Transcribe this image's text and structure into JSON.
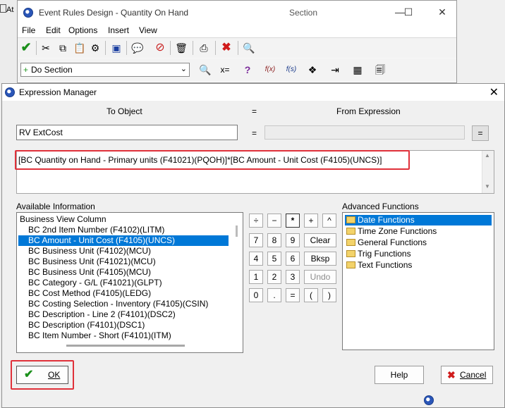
{
  "background_window": {
    "partial_label": "At"
  },
  "event_rules_window": {
    "title": "Event Rules Design - Quantity On Hand",
    "section_label": "Section",
    "menu": [
      "File",
      "Edit",
      "Options",
      "Insert",
      "View"
    ],
    "combo_value": "Do Section",
    "formula_icons": [
      "f(x)",
      "f(s)"
    ],
    "tb2_equals": "x=",
    "tb2_question": "?"
  },
  "dialog": {
    "title": "Expression Manager",
    "to_object_header": "To Object",
    "equals_header": "=",
    "from_expression_header": "From Expression",
    "to_object_value": "RV ExtCost",
    "equals_sign": "=",
    "equals_button": "=",
    "expression": "[BC Quantity on Hand - Primary units (F41021)(PQOH)]*[BC Amount - Unit Cost (F4105)(UNCS)]",
    "available_info_label": "Available Information",
    "list_header": "Business View Column",
    "list_items": [
      "BC 2nd Item Number (F4102)(LITM)",
      "BC Amount - Unit Cost (F4105)(UNCS)",
      "BC Business Unit (F4102)(MCU)",
      "BC Business Unit (F41021)(MCU)",
      "BC Business Unit (F4105)(MCU)",
      "BC Category - G/L (F41021)(GLPT)",
      "BC Cost Method (F4105)(LEDG)",
      "BC Costing Selection - Inventory (F4105)(CSIN)",
      "BC Description - Line 2 (F4101)(DSC2)",
      "BC Description (F4101)(DSC1)",
      "BC Item Number - Short (F4101)(ITM)"
    ],
    "selected_list_item_index": 1,
    "keypad": {
      "operators": [
        "÷",
        "−",
        "*",
        "+",
        "^"
      ],
      "row1": [
        "7",
        "8",
        "9"
      ],
      "row2": [
        "4",
        "5",
        "6"
      ],
      "row3": [
        "1",
        "2",
        "3"
      ],
      "row4": [
        "0",
        ".",
        "=",
        "(",
        ")"
      ],
      "clear": "Clear",
      "bksp": "Bksp",
      "undo": "Undo"
    },
    "advanced_label": "Advanced Functions",
    "advanced_items": [
      "Date Functions",
      "Time Zone Functions",
      "General Functions",
      "Trig Functions",
      "Text Functions"
    ],
    "selected_advanced_index": 0,
    "ok_label": "OK",
    "help_label": "Help",
    "cancel_label": "Cancel"
  },
  "colors": {
    "selection": "#0078d7",
    "highlight_box": "#e0313a"
  }
}
